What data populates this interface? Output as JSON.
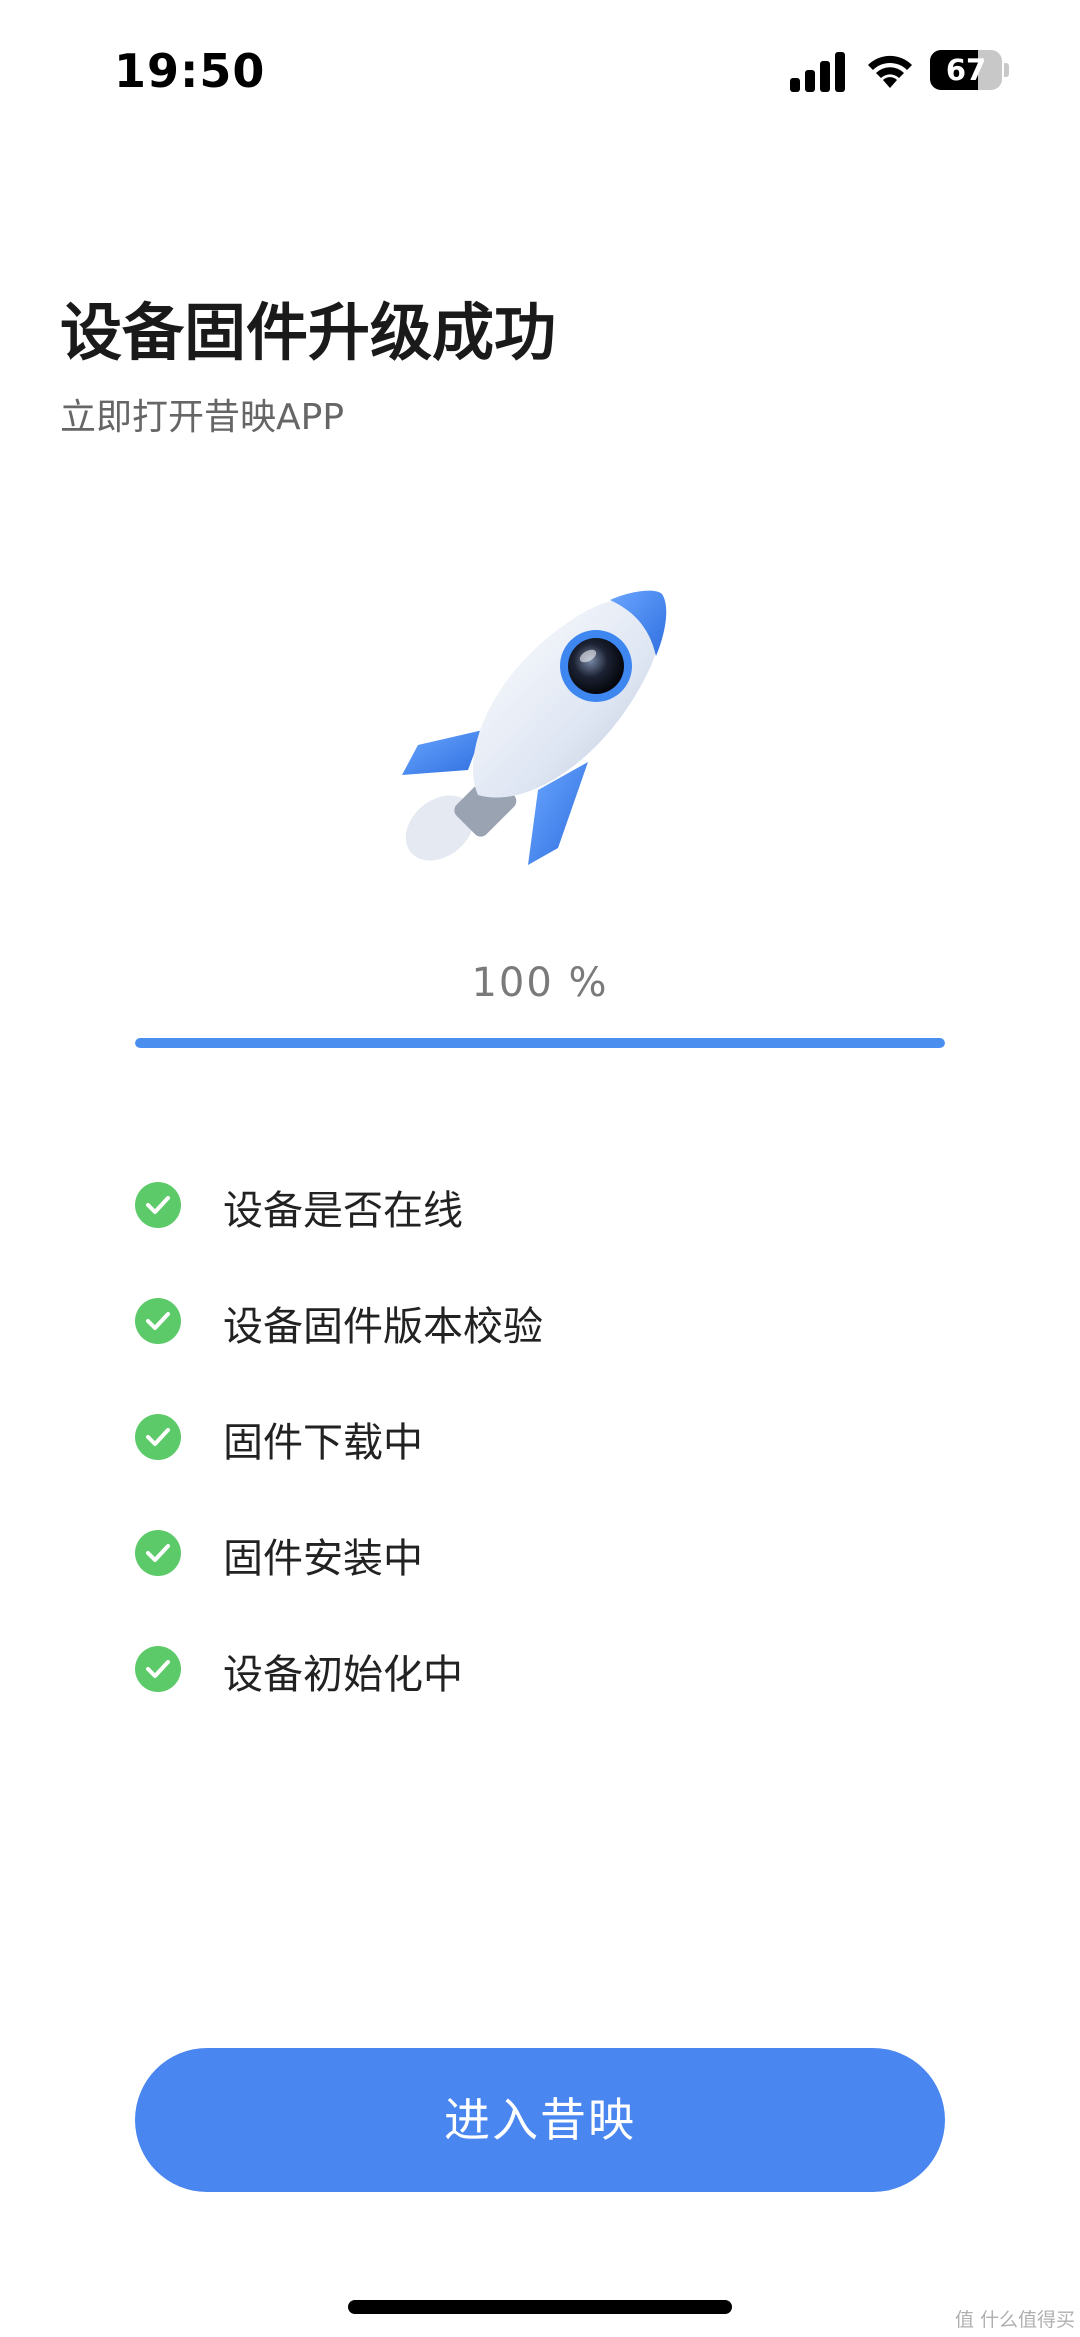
{
  "status_bar": {
    "time": "19:50",
    "battery_level": "67",
    "battery_fraction": 0.67,
    "icons": [
      "signal-icon",
      "wifi-icon",
      "battery-icon"
    ]
  },
  "header": {
    "title": "设备固件升级成功",
    "subtitle": "立即打开昔映APP"
  },
  "illustration": {
    "icon": "rocket-icon",
    "colors": {
      "body": "#e9eef7",
      "fin": "#3e86f0"
    }
  },
  "progress": {
    "label": "100 %",
    "value": 1.0,
    "color": "#4a8ef0"
  },
  "steps": [
    {
      "label": "设备是否在线",
      "status": "done"
    },
    {
      "label": "设备固件版本校验",
      "status": "done"
    },
    {
      "label": "固件下载中",
      "status": "done"
    },
    {
      "label": "固件安装中",
      "status": "done"
    },
    {
      "label": "设备初始化中",
      "status": "done"
    }
  ],
  "check_color": "#5dca6a",
  "primary_button": {
    "label": "进入昔映",
    "color": "#4a86ef"
  },
  "watermark": "值 什么值得买"
}
